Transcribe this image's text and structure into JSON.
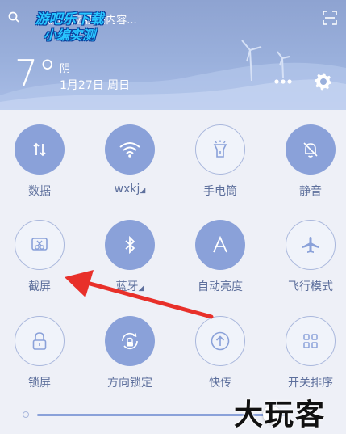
{
  "header": {
    "search_text": "游戏,应用,网内容...",
    "temperature": "7°",
    "condition": "阴",
    "date": "1月27日 周日"
  },
  "watermarks": {
    "top_line1": "游吧乐下载",
    "top_line2": "小编实测",
    "bottom": "大玩客"
  },
  "tiles": [
    {
      "label": "数据",
      "icon": "data-icon",
      "state": "on"
    },
    {
      "label": "wxkj",
      "icon": "wifi-icon",
      "state": "on",
      "has_arrow": true
    },
    {
      "label": "手电筒",
      "icon": "flashlight-icon",
      "state": "off"
    },
    {
      "label": "静音",
      "icon": "mute-bell-icon",
      "state": "on"
    },
    {
      "label": "截屏",
      "icon": "screenshot-icon",
      "state": "off"
    },
    {
      "label": "蓝牙",
      "icon": "bluetooth-icon",
      "state": "on",
      "has_arrow": true
    },
    {
      "label": "自动亮度",
      "icon": "auto-brightness-icon",
      "state": "on"
    },
    {
      "label": "飞行模式",
      "icon": "airplane-icon",
      "state": "off"
    },
    {
      "label": "锁屏",
      "icon": "lock-icon",
      "state": "off"
    },
    {
      "label": "方向锁定",
      "icon": "rotation-lock-icon",
      "state": "on"
    },
    {
      "label": "快传",
      "icon": "quick-transfer-icon",
      "state": "off"
    },
    {
      "label": "开关排序",
      "icon": "sort-grid-icon",
      "state": "off"
    }
  ],
  "brightness": {
    "level": 0.9
  },
  "colors": {
    "accent": "#8aa1d9",
    "label": "#5d6f9c",
    "annotation_arrow": "#e8302a"
  }
}
